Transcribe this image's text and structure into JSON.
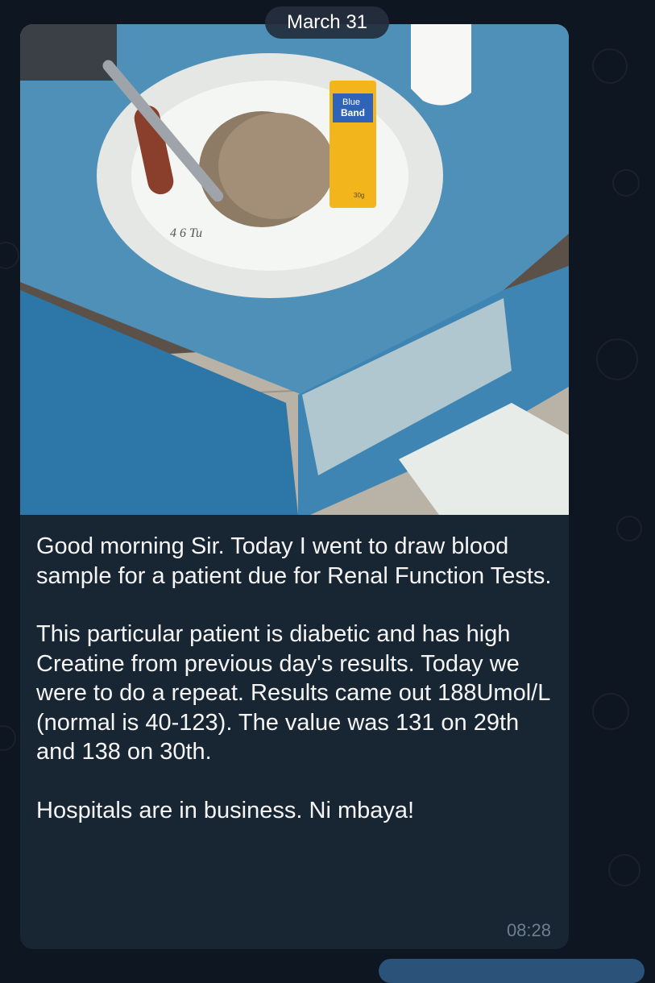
{
  "chat": {
    "date_separator": "March 31",
    "message": {
      "paragraph_1": "Good morning Sir. Today I went to draw blood sample for a patient due for Renal Function Tests.",
      "paragraph_2": "This particular patient is diabetic and has high Creatine from previous day's results. Today we were to do a repeat. Results came out 188Umol/L (normal is 40-123). The value was 131 on 29th and 138 on 30th.",
      "paragraph_3": "Hospitals are in business. Ni mbaya!",
      "time": "08:28",
      "photo_label_brand_top": "Blue",
      "photo_label_brand_bottom": "Band",
      "photo_label_weight": "30g",
      "photo_plate_writing": "4 6 Tu"
    }
  },
  "colors": {
    "background": "#0e1621",
    "incoming_bubble": "#182533",
    "outgoing_bubble": "#2b5278",
    "timestamp": "#6d7f8f"
  }
}
